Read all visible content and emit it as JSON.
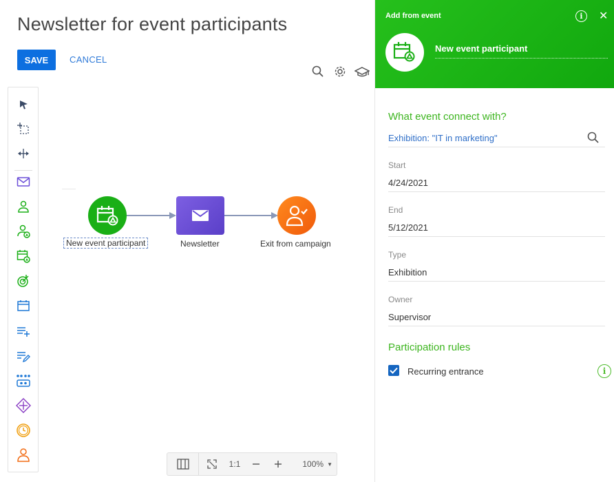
{
  "page": {
    "title": "Newsletter for event participants",
    "save_label": "SAVE",
    "cancel_label": "CANCEL"
  },
  "toolbar_icons": [
    "search-icon",
    "gear-icon",
    "graduation-cap-icon"
  ],
  "toolbox": {
    "items": [
      "pointer-icon",
      "area-select-icon",
      "horizontal-pan-icon",
      "email-icon",
      "add-audience-icon",
      "event-audience-icon",
      "add-from-event-icon",
      "landing-target-icon",
      "event-calendar-icon",
      "add-data-icon",
      "modify-data-icon",
      "process-icon",
      "rule-icon",
      "timer-icon",
      "exit-icon"
    ]
  },
  "diagram": {
    "nodes": [
      {
        "label": "New event participant",
        "color": "#1aaf16",
        "icon": "calendar-event-icon",
        "selected": true
      },
      {
        "label": "Newsletter",
        "color": "#6b4fd8",
        "icon": "envelope-icon"
      },
      {
        "label": "Exit from campaign",
        "color": "#f26b13",
        "icon": "person-exit-icon"
      }
    ]
  },
  "zoom_bar": {
    "fit_label": "1:1",
    "zoom_value": "100%"
  },
  "panel": {
    "header_title": "Add from event",
    "element_name": "New event participant",
    "event_section_title": "What event connect with?",
    "event_value": "Exhibition: \"IT in marketing\"",
    "fields": [
      {
        "label": "Start",
        "value": "4/24/2021"
      },
      {
        "label": "End",
        "value": "5/12/2021"
      },
      {
        "label": "Type",
        "value": "Exhibition"
      },
      {
        "label": "Owner",
        "value": "Supervisor"
      }
    ],
    "rules_section_title": "Participation rules",
    "recurring_label": "Recurring entrance",
    "recurring_checked": true
  },
  "colors": {
    "accent_blue": "#0d6fe0",
    "panel_green": "#1aaf16",
    "section_green": "#3db51f",
    "link_blue": "#2f6fc8"
  }
}
